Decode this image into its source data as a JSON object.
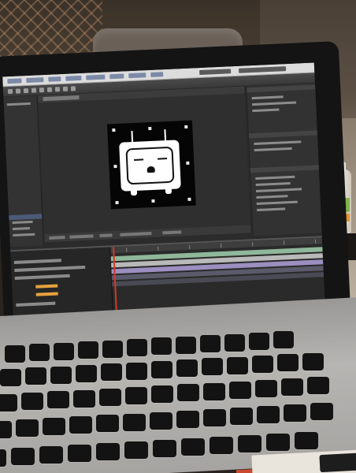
{
  "scene": {
    "description_free": true
  },
  "colors": {
    "screen_bg": "#2b2b2b",
    "menubar": "#dcdcdc",
    "mascot": "#ffffff",
    "playhead": "#d23a2a",
    "keyframe": "#e6a23c"
  },
  "icons": [
    "mascot-icon"
  ]
}
